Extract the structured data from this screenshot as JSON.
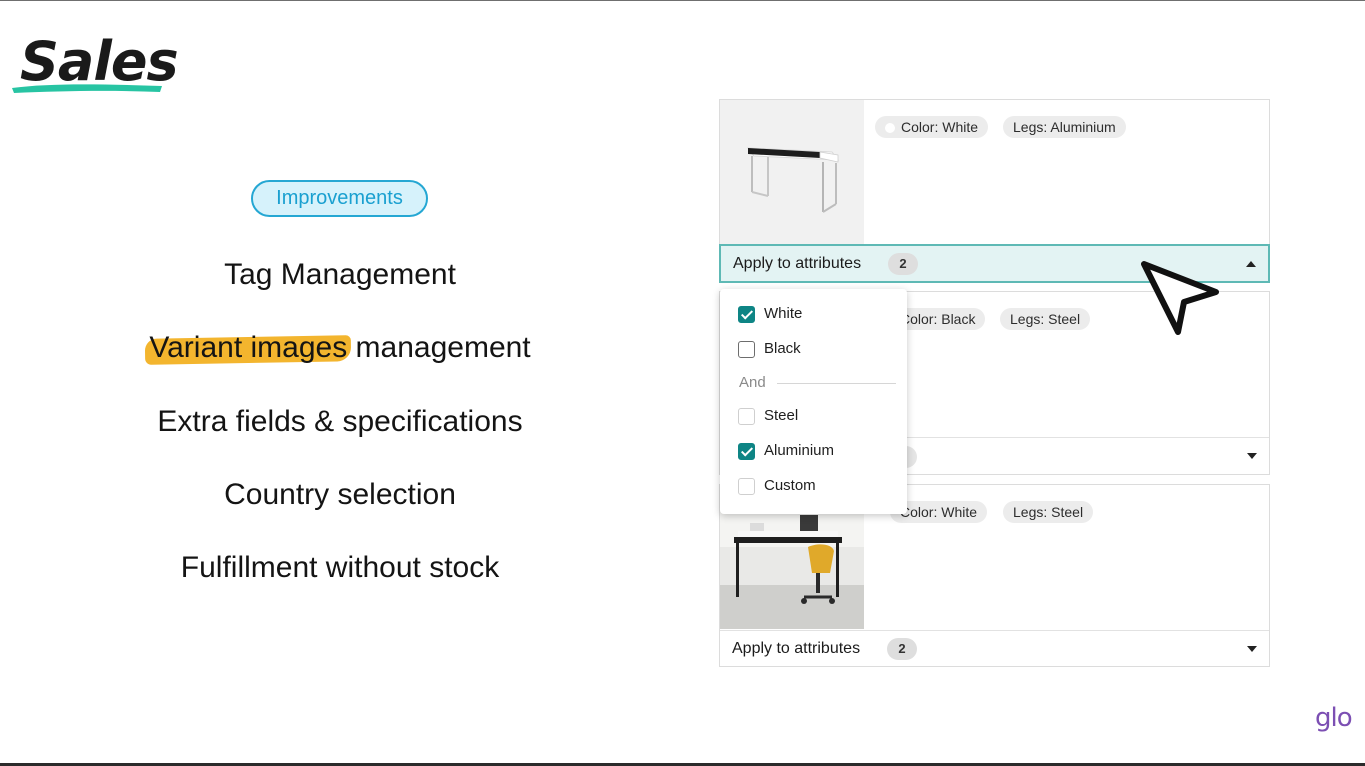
{
  "logo": {
    "text": "Sales",
    "swoosh_color": "#27c4a3"
  },
  "badge": {
    "label": "Improvements",
    "color": "#25a7d3"
  },
  "features": {
    "tag_management": "Tag Management",
    "variant_highlight": "Variant images",
    "variant_rest": " management",
    "extra_fields": "Extra fields & specifications",
    "country": "Country selection",
    "fulfillment": "Fulfillment without stock"
  },
  "variants": [
    {
      "chips": [
        "Color: White",
        "Legs: Aluminium"
      ],
      "apply_label": "Apply to attributes",
      "count": "2",
      "expanded": true
    },
    {
      "chips": [
        "Color: Black",
        "Legs: Steel"
      ],
      "expanded": false
    },
    {
      "chips": [
        "Color: White",
        "Legs: Steel"
      ],
      "apply_label": "Apply to attributes",
      "count": "2",
      "expanded": false
    }
  ],
  "dropdown": {
    "options": [
      {
        "label": "White",
        "checked": true
      },
      {
        "label": "Black",
        "checked": false
      },
      {
        "label": "Steel",
        "checked": false
      },
      {
        "label": "Aluminium",
        "checked": true
      },
      {
        "label": "Custom",
        "checked": false
      }
    ],
    "separator": "And"
  },
  "brand": {
    "text": "glo",
    "color": "#7c4fb3"
  },
  "accent": {
    "teal": "#0e8585",
    "highlight": "#f3b52e"
  }
}
